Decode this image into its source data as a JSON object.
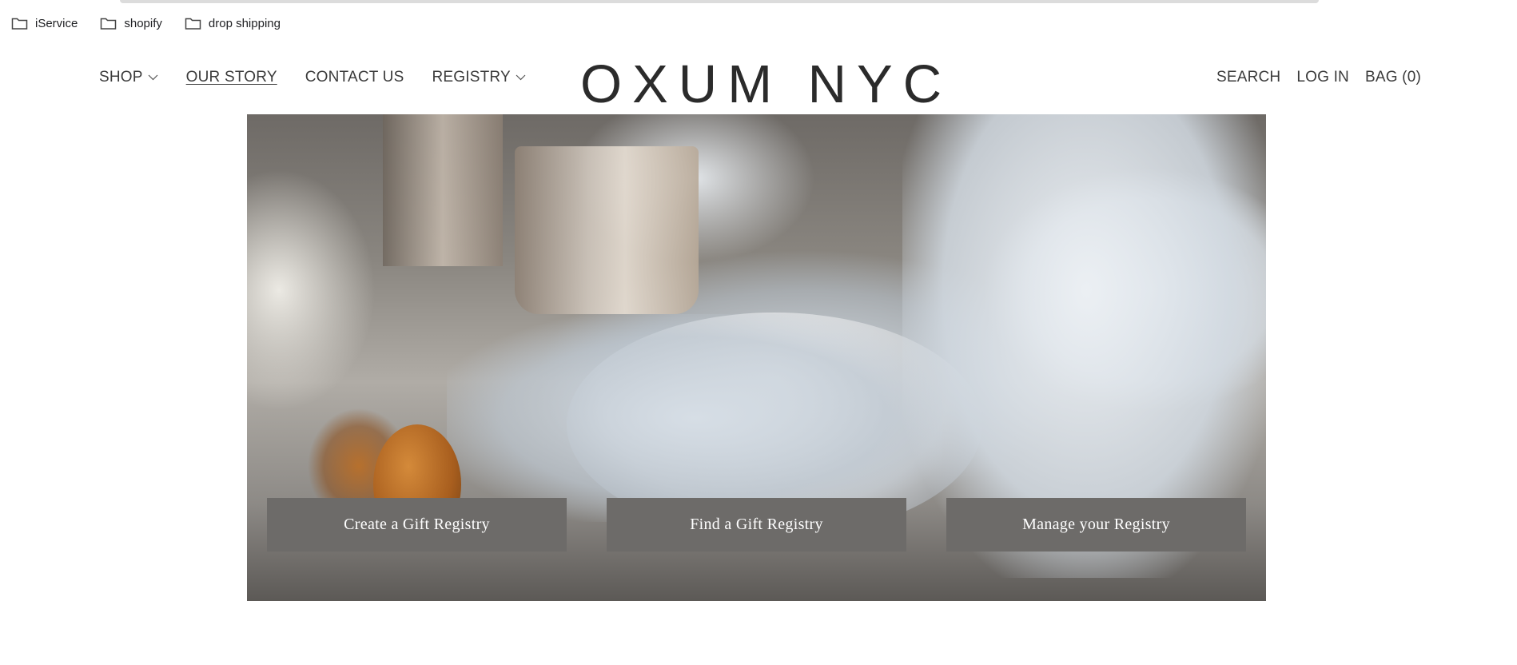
{
  "bookmarks": [
    {
      "label": "iService",
      "icon": "folder-icon"
    },
    {
      "label": "shopify",
      "icon": "folder-icon"
    },
    {
      "label": "drop shipping",
      "icon": "folder-icon"
    }
  ],
  "header": {
    "logo": "OXUM NYC",
    "nav_left": [
      {
        "label": "SHOP",
        "has_dropdown": true
      },
      {
        "label": "OUR STORY",
        "active": true
      },
      {
        "label": "CONTACT US"
      },
      {
        "label": "REGISTRY",
        "has_dropdown": true
      }
    ],
    "nav_right": [
      {
        "label": "SEARCH"
      },
      {
        "label": "LOG IN"
      },
      {
        "label": "BAG (0)"
      }
    ]
  },
  "hero": {
    "buttons": [
      {
        "label": "Create a Gift Registry"
      },
      {
        "label": "Find a Gift Registry"
      },
      {
        "label": "Manage your Registry"
      }
    ]
  },
  "colors": {
    "button_bg": "#6d6b69",
    "nav_text": "#3b3b3b",
    "logo_text": "#2b2b2b"
  }
}
